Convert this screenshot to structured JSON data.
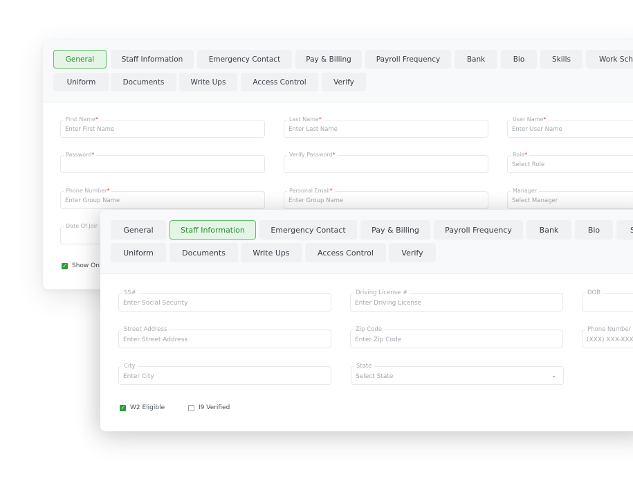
{
  "card_general": {
    "tabs_row1": [
      "General",
      "Staff Information",
      "Emergency Contact",
      "Pay & Billing",
      "Payroll Frequency",
      "Bank",
      "Bio",
      "Skills",
      "Work Sche"
    ],
    "tabs_row2": [
      "Uniform",
      "Documents",
      "Write Ups",
      "Access Control",
      "Verify"
    ],
    "active_tab": "General",
    "fields": [
      {
        "label": "First Name",
        "required": "*",
        "placeholder": "Enter First Name"
      },
      {
        "label": "Last Name",
        "required": "*",
        "placeholder": "Enter Last Name"
      },
      {
        "label": "User Name",
        "required": "*",
        "placeholder": "Enter User Name"
      },
      {
        "label": "Password",
        "required": "*",
        "placeholder": ""
      },
      {
        "label": "Verify Password",
        "required": "*",
        "placeholder": ""
      },
      {
        "label": "Role",
        "required": "*",
        "placeholder": "Select Role"
      },
      {
        "label": "Phone Number",
        "required": "*",
        "placeholder": "Enter Group Name"
      },
      {
        "label": "Personal Email",
        "required": "*",
        "placeholder": "Enter Group Name"
      },
      {
        "label": "Manager",
        "required": "",
        "placeholder": "Select Manager"
      },
      {
        "label": "Date Of Joir",
        "required": "",
        "placeholder": ""
      }
    ],
    "checkbox": {
      "label": "Show On I",
      "checked": true
    }
  },
  "card_staff": {
    "tabs_row1": [
      "General",
      "Staff Information",
      "Emergency Contact",
      "Pay & Billing",
      "Payroll Frequency",
      "Bank",
      "Bio",
      "S"
    ],
    "tabs_row2": [
      "Uniform",
      "Documents",
      "Write Ups",
      "Access Control",
      "Verify"
    ],
    "active_tab": "Staff Information",
    "fields": [
      {
        "label": "SS#",
        "placeholder": "Enter Social Security"
      },
      {
        "label": "Driving License #",
        "placeholder": "Enter Driving License"
      },
      {
        "label": "DOB",
        "placeholder": ""
      },
      {
        "label": "Street Address",
        "placeholder": "Enter Street Address"
      },
      {
        "label": "Zip Code",
        "placeholder": "Enter Zip Code"
      },
      {
        "label": "Phone Number",
        "placeholder": "(XXX) XXX-XXX"
      },
      {
        "label": "City",
        "placeholder": "Enter City"
      },
      {
        "label": "State",
        "placeholder": "Select State"
      }
    ],
    "checkboxes": [
      {
        "label": "W2 Eligible",
        "checked": true
      },
      {
        "label": "I9 Verified",
        "checked": false
      }
    ]
  },
  "colors": {
    "accent": "#2e8b36",
    "active_tab_bg": "#e4f4e5",
    "required": "#e53935"
  }
}
